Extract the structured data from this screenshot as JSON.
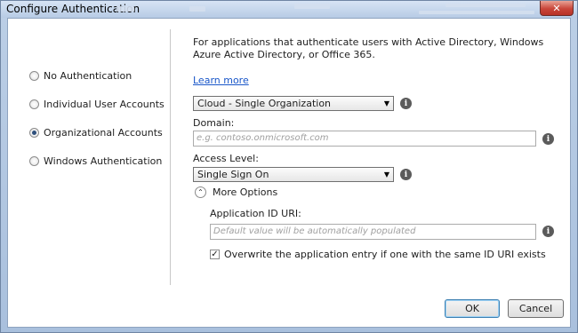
{
  "window": {
    "title": "Configure Authentication",
    "close_glyph": "✕"
  },
  "auth_options": [
    {
      "label": "No Authentication",
      "selected": false
    },
    {
      "label": "Individual User Accounts",
      "selected": false
    },
    {
      "label": "Organizational Accounts",
      "selected": true
    },
    {
      "label": "Windows Authentication",
      "selected": false
    }
  ],
  "description": "For applications that authenticate users with Active Directory, Windows Azure Active Directory, or Office 365.",
  "learn_more": "Learn more",
  "org_type": {
    "value": "Cloud - Single Organization"
  },
  "domain": {
    "label": "Domain:",
    "placeholder": "e.g. contoso.onmicrosoft.com"
  },
  "access_level": {
    "label": "Access Level:",
    "value": "Single Sign On"
  },
  "more_options": {
    "label": "More Options",
    "expanded": true
  },
  "app_id_uri": {
    "label": "Application ID URI:",
    "placeholder": "Default value will be automatically populated"
  },
  "overwrite": {
    "label": "Overwrite the application entry if one with the same ID URI exists",
    "checked": true,
    "check_glyph": "✓"
  },
  "info_glyph": "i",
  "dropdown_glyph": "▼",
  "expander_glyph": "⌃",
  "buttons": {
    "ok": "OK",
    "cancel": "Cancel"
  }
}
